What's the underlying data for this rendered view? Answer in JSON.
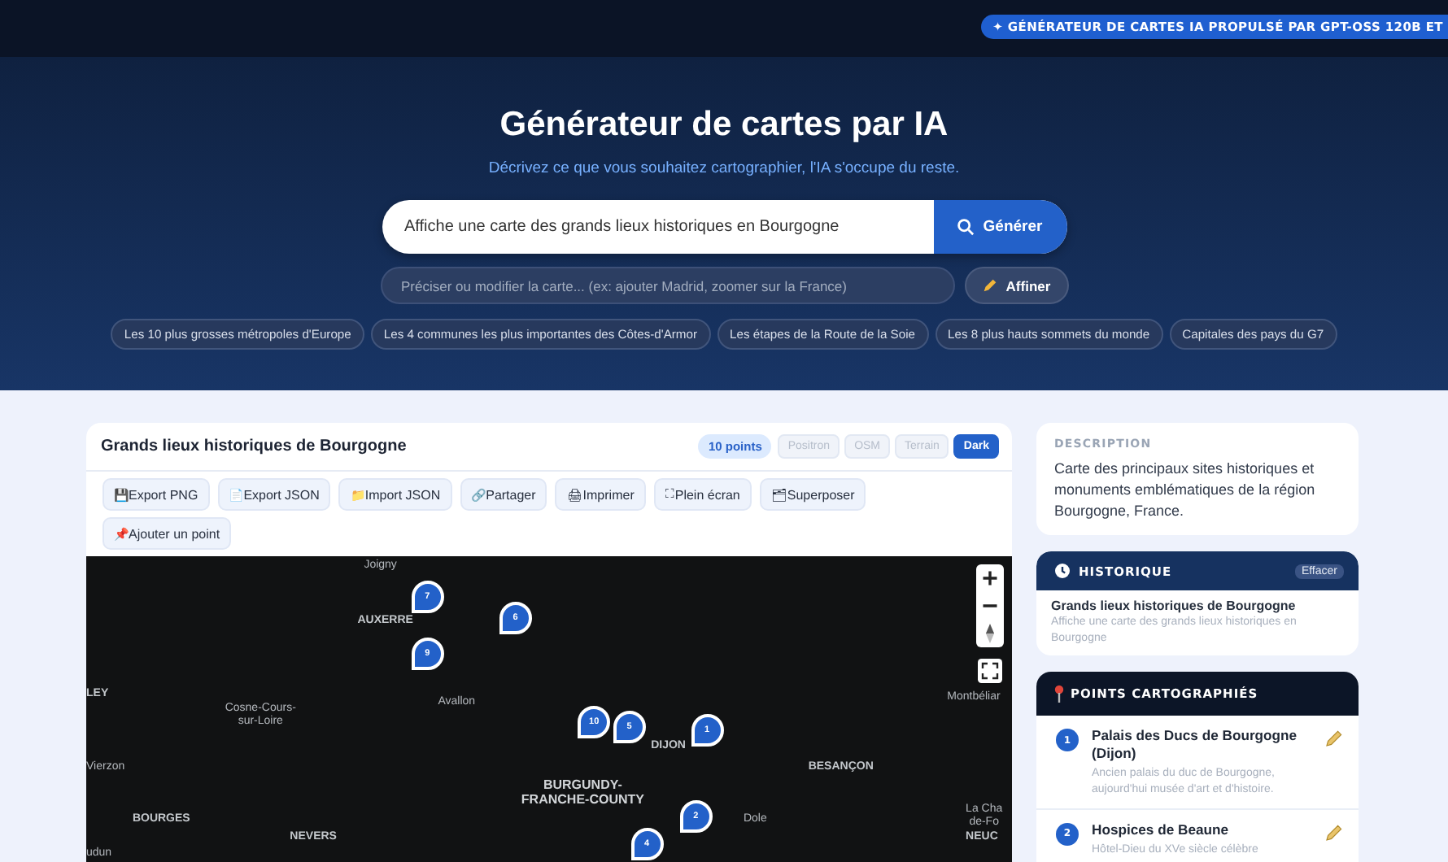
{
  "top_badge": "✦ GÉNÉRATEUR DE CARTES IA PROPULSÉ PAR GPT-OSS 120B ET",
  "hero": {
    "title": "Générateur de cartes par IA",
    "subtitle": "Décrivez ce que vous souhaitez cartographier, l'IA s'occupe du reste.",
    "search": {
      "value": "Affiche une carte des grands lieux historiques en Bourgogne",
      "button": "Générer"
    },
    "refine": {
      "placeholder": "Préciser ou modifier la carte... (ex: ajouter Madrid, zoomer sur la France)",
      "button": "Affiner"
    },
    "suggestions": [
      "Les 10 plus grosses métropoles d'Europe",
      "Les 4 communes les plus importantes des Côtes-d'Armor",
      "Les étapes de la Route de la Soie",
      "Les 8 plus hauts sommets du monde",
      "Capitales des pays du G7"
    ]
  },
  "map_card": {
    "title": "Grands lieux historiques de Bourgogne",
    "count": "10 points",
    "styles": [
      {
        "label": "Positron",
        "selected": false
      },
      {
        "label": "OSM",
        "selected": false
      },
      {
        "label": "Terrain",
        "selected": false
      },
      {
        "label": "Dark",
        "selected": true
      }
    ],
    "tools": [
      {
        "icon": "💾",
        "label": "Export PNG"
      },
      {
        "icon": "📄",
        "label": "Export JSON"
      },
      {
        "icon": "📁",
        "label": "Import JSON"
      },
      {
        "icon": "🔗",
        "label": "Partager"
      },
      {
        "icon": "🖨",
        "label": "Imprimer"
      },
      {
        "icon": "⛶",
        "label": "Plein écran"
      },
      {
        "icon": "🗂",
        "label": "Superposer"
      },
      {
        "icon": "📌",
        "label": "Ajouter un point"
      }
    ],
    "map": {
      "places": [
        {
          "label": "Joigny",
          "kind": "town"
        },
        {
          "label": "AUXERRE",
          "kind": "city"
        },
        {
          "label": "LEY",
          "kind": "city"
        },
        {
          "label": "Cosne-Cours-\nsur-Loire",
          "kind": "town"
        },
        {
          "label": "Avallon",
          "kind": "town"
        },
        {
          "label": "Montbéliar",
          "kind": "town"
        },
        {
          "label": "DIJON",
          "kind": "city"
        },
        {
          "label": "Vierzon",
          "kind": "town"
        },
        {
          "label": "BESANÇON",
          "kind": "city"
        },
        {
          "label": "BURGUNDY-\nFRANCHE-COUNTY",
          "kind": "region"
        },
        {
          "label": "BOURGES",
          "kind": "city"
        },
        {
          "label": "Dole",
          "kind": "town"
        },
        {
          "label": "La Cha\nde-Fo",
          "kind": "town"
        },
        {
          "label": "NEVERS",
          "kind": "city"
        },
        {
          "label": "NEUC",
          "kind": "city"
        },
        {
          "label": "udun",
          "kind": "town"
        }
      ],
      "markers": [
        {
          "label": "7"
        },
        {
          "label": "6"
        },
        {
          "label": "9"
        },
        {
          "label": "10"
        },
        {
          "label": "5"
        },
        {
          "label": "1"
        },
        {
          "label": "2"
        },
        {
          "label": "4"
        }
      ]
    }
  },
  "description": {
    "heading": "DESCRIPTION",
    "text": "Carte des principaux sites historiques et monuments emblématiques de la région Bourgogne, France."
  },
  "history": {
    "heading": "HISTORIQUE",
    "clear": "Effacer",
    "items": [
      {
        "title": "Grands lieux historiques de Bourgogne",
        "prompt": "Affiche une carte des grands lieux historiques en Bourgogne"
      }
    ]
  },
  "points": {
    "heading": "POINTS CARTOGRAPHIÉS",
    "items": [
      {
        "number": "1",
        "name": "Palais des Ducs de Bourgogne (Dijon)",
        "text": "Ancien palais du duc de Bourgogne, aujourd'hui musée d'art et d'histoire."
      },
      {
        "number": "2",
        "name": "Hospices de Beaune",
        "text": "Hôtel-Dieu du XVe siècle célèbre"
      }
    ]
  }
}
